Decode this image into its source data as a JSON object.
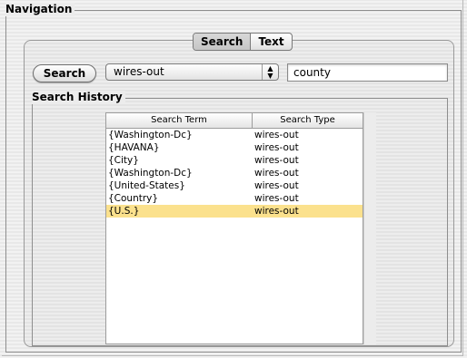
{
  "navigation": {
    "title": "Navigation",
    "tabs": [
      {
        "label": "Search",
        "selected": true
      },
      {
        "label": "Text",
        "selected": false
      }
    ]
  },
  "search": {
    "button_label": "Search",
    "type_select_value": "wires-out",
    "query_value": "county"
  },
  "history": {
    "title": "Search History",
    "columns": [
      "Search Term",
      "Search Type"
    ],
    "rows": [
      {
        "term": "{Washington-Dc}",
        "type": "wires-out",
        "selected": false
      },
      {
        "term": "{HAVANA}",
        "type": "wires-out",
        "selected": false
      },
      {
        "term": "{City}",
        "type": "wires-out",
        "selected": false
      },
      {
        "term": "{Washington-Dc}",
        "type": "wires-out",
        "selected": false
      },
      {
        "term": "{United-States}",
        "type": "wires-out",
        "selected": false
      },
      {
        "term": "{Country}",
        "type": "wires-out",
        "selected": false
      },
      {
        "term": "{U.S.}",
        "type": "wires-out",
        "selected": true
      }
    ]
  },
  "colors": {
    "selected_row": "#fbe18d",
    "background": "#ececec"
  }
}
